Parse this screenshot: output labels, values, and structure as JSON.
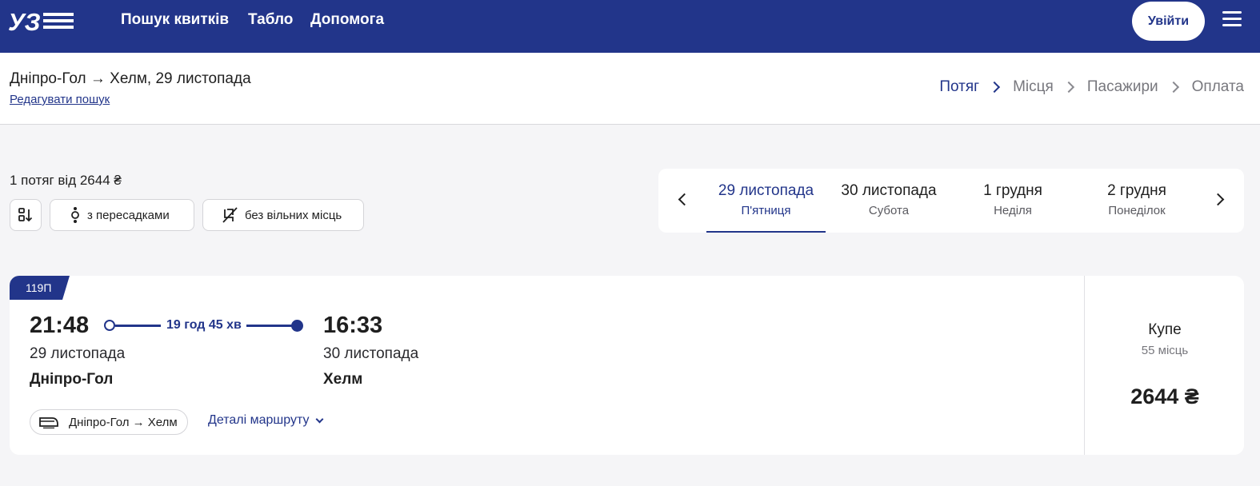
{
  "nav": {
    "logo_text": "УЗ",
    "links": [
      "Пошук квитків",
      "Табло",
      "Допомога"
    ],
    "login_label": "Увійти"
  },
  "search": {
    "route_title": "Дніпро-Гол → Хелм, 29 листопада",
    "edit_label": "Редагувати пошук"
  },
  "steps": [
    "Потяг",
    "Місця",
    "Пасажири",
    "Оплата"
  ],
  "filters": {
    "count_text": "1 потяг від 2644 ₴",
    "transfers_label": "з пересадками",
    "no_seats_label": "без вільних місць"
  },
  "dates": [
    {
      "date": "29 листопада",
      "weekday": "П'ятниця",
      "active": true
    },
    {
      "date": "30 листопада",
      "weekday": "Субота",
      "active": false
    },
    {
      "date": "1 грудня",
      "weekday": "Неділя",
      "active": false
    },
    {
      "date": "2 грудня",
      "weekday": "Понеділок",
      "active": false
    }
  ],
  "train": {
    "number": "119П",
    "depart_time": "21:48",
    "depart_date": "29 листопада",
    "depart_station": "Дніпро-Гол",
    "duration": "19 год 45 хв",
    "arrive_time": "16:33",
    "arrive_date": "30 листопада",
    "arrive_station": "Хелм",
    "route_label": "Дніпро-Гол → Хелм",
    "details_label": "Деталі маршруту",
    "class_name": "Купе",
    "seats": "55 місць",
    "price": "2644 ₴"
  },
  "colors": {
    "brand": "#22358a",
    "background": "#f5f5f7"
  }
}
